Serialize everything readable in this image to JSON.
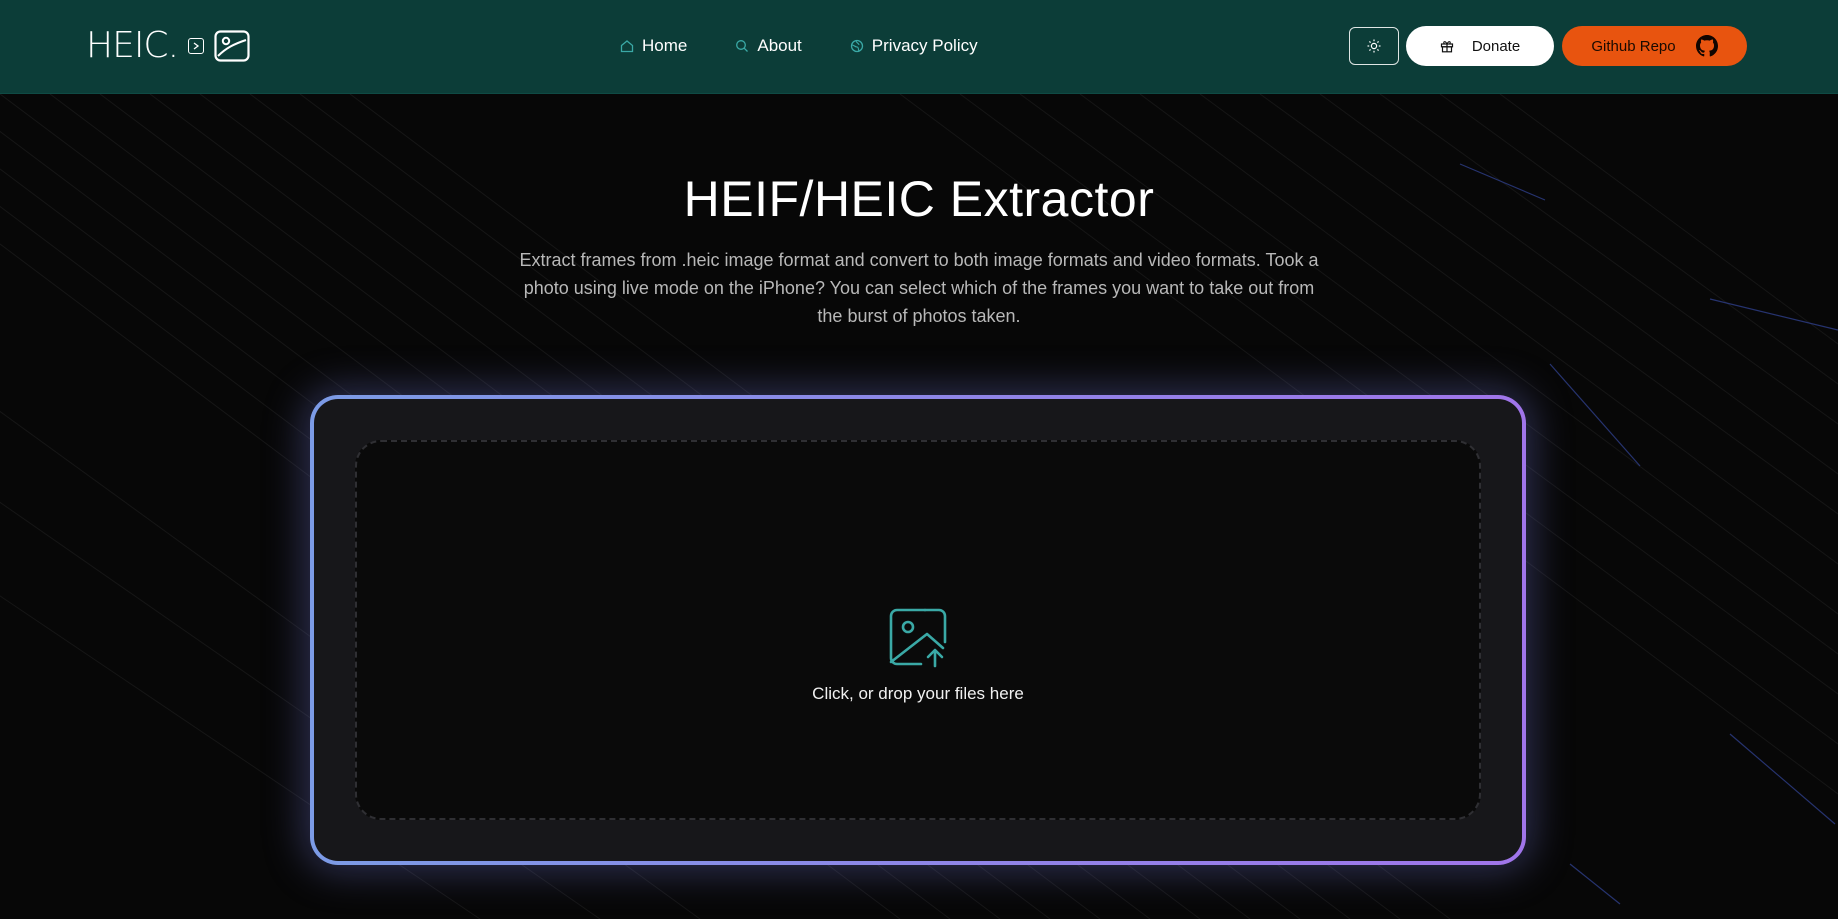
{
  "header": {
    "logo_text": "HEIC.",
    "nav": [
      {
        "label": "Home",
        "icon": "home-icon"
      },
      {
        "label": "About",
        "icon": "search-icon"
      },
      {
        "label": "Privacy Policy",
        "icon": "globe-icon"
      }
    ],
    "theme_toggle_icon": "sun-icon",
    "donate_label": "Donate",
    "github_label": "Github Repo"
  },
  "hero": {
    "title": "HEIF/HEIC Extractor",
    "description": "Extract frames from .heic image format and convert to both image formats and video formats. Took a photo using live mode on the iPhone? You can select which of the frames you want to take out from the burst of photos taken."
  },
  "upload": {
    "prompt": "Click, or drop your files here",
    "icon": "image-upload-icon"
  },
  "colors": {
    "header_bg": "#0c3d38",
    "github_button": "#e8540f",
    "accent_teal": "#3aa9a6",
    "card_border_start": "#7c9be6",
    "card_border_end": "#a075ea"
  }
}
